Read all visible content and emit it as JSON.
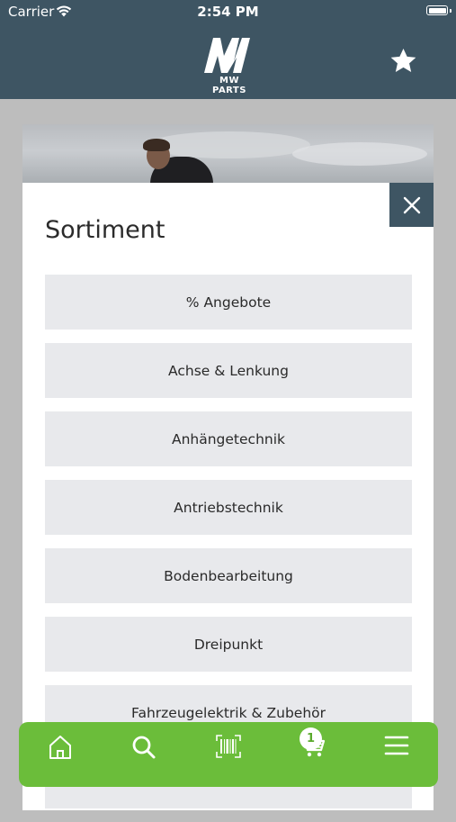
{
  "status_bar": {
    "carrier": "Carrier",
    "time": "2:54 PM"
  },
  "header": {
    "logo_text": "MW PARTS",
    "logo_mark": "MW",
    "favorite_icon": "star-icon"
  },
  "modal": {
    "title": "Sortiment",
    "close_icon": "close-icon",
    "categories": [
      "% Angebote",
      "Achse & Lenkung",
      "Anhängetechnik",
      "Antriebstechnik",
      "Bodenbearbeitung",
      "Dreipunkt",
      "Fahrzeugelektrik & Zubehör",
      ""
    ]
  },
  "bottom_nav": {
    "items": [
      "home-icon",
      "search-icon",
      "barcode-icon",
      "cart-icon",
      "menu-icon"
    ],
    "cart_count": "1"
  },
  "colors": {
    "header_bg": "#3e5563",
    "nav_green": "#6bbd3a",
    "item_bg": "#e8e9ec",
    "overlay": "#bdbdbd"
  }
}
